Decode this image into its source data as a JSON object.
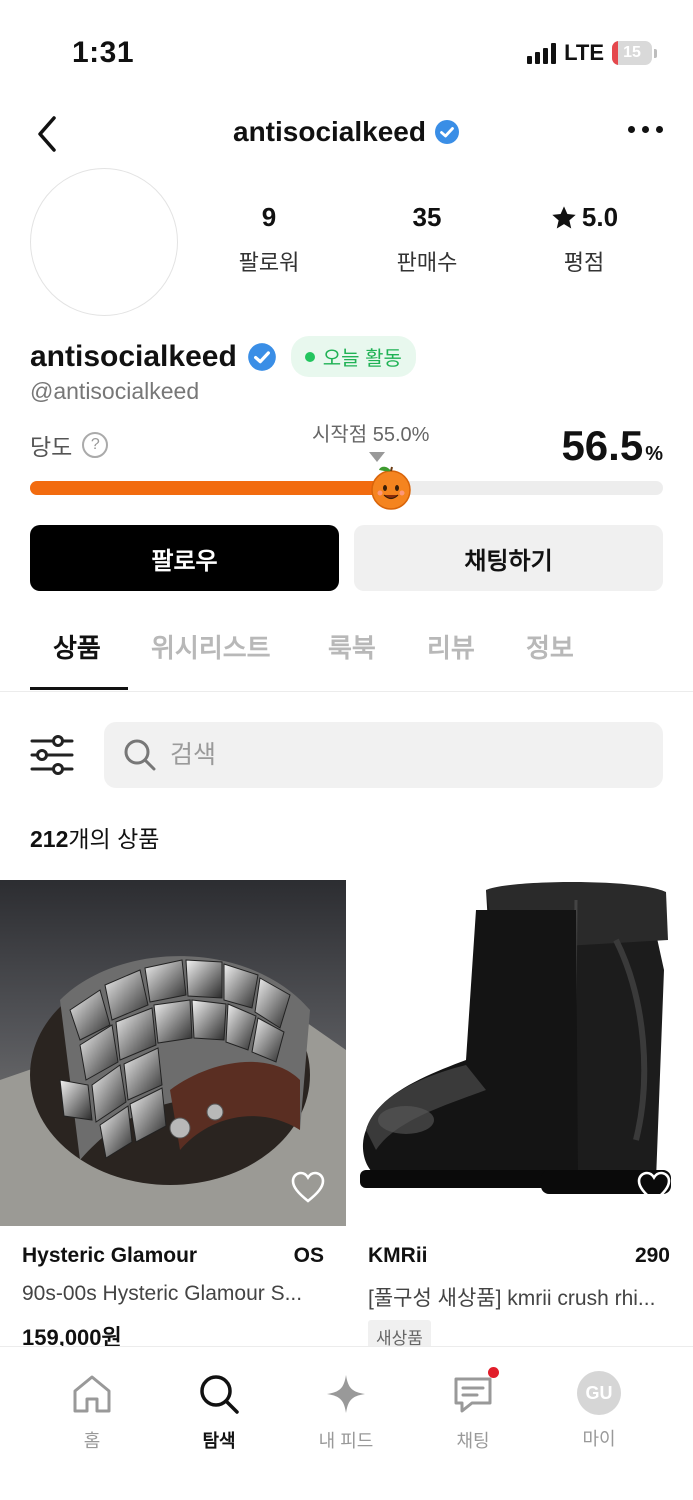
{
  "status": {
    "time": "1:31",
    "network": "LTE",
    "battery": "15",
    "battery_level": 0.15
  },
  "header": {
    "title": "antisocialkeed"
  },
  "profile": {
    "name": "antisocialkeed",
    "handle": "@antisocialkeed",
    "active_badge": "오늘 활동",
    "stats": [
      {
        "value": "9",
        "label": "팔로워"
      },
      {
        "value": "35",
        "label": "판매수"
      },
      {
        "value": "5.0",
        "label": "평점"
      }
    ]
  },
  "dangdo": {
    "label": "당도",
    "start_label": "시작점 55.0%",
    "score": "56.5",
    "unit": "%",
    "level": 0.565
  },
  "actions": {
    "follow": "팔로우",
    "chat": "채팅하기"
  },
  "tabs": [
    "상품",
    "위시리스트",
    "룩북",
    "리뷰",
    "정보"
  ],
  "search": {
    "placeholder": "검색"
  },
  "product_count": {
    "number": "212",
    "suffix": "개의 상품"
  },
  "products": [
    {
      "brand": "Hysteric Glamour",
      "size": "OS",
      "title": "90s-00s Hysteric Glamour S...",
      "price": "159,000원"
    },
    {
      "brand": "KMRii",
      "size": "290",
      "title": "[풀구성 새상품] kmrii crush rhi...",
      "tag": "새상품"
    }
  ],
  "nav": [
    {
      "label": "홈",
      "icon": "home-icon"
    },
    {
      "label": "탐색",
      "icon": "search-icon"
    },
    {
      "label": "내 피드",
      "icon": "sparkle-icon"
    },
    {
      "label": "채팅",
      "icon": "chat-icon"
    },
    {
      "label": "마이",
      "icon": "avatar",
      "avatar_text": "GU"
    }
  ],
  "colors": {
    "accent": "#f26b0f",
    "active_green": "#20b255",
    "verified_blue": "#3a8ee6"
  }
}
